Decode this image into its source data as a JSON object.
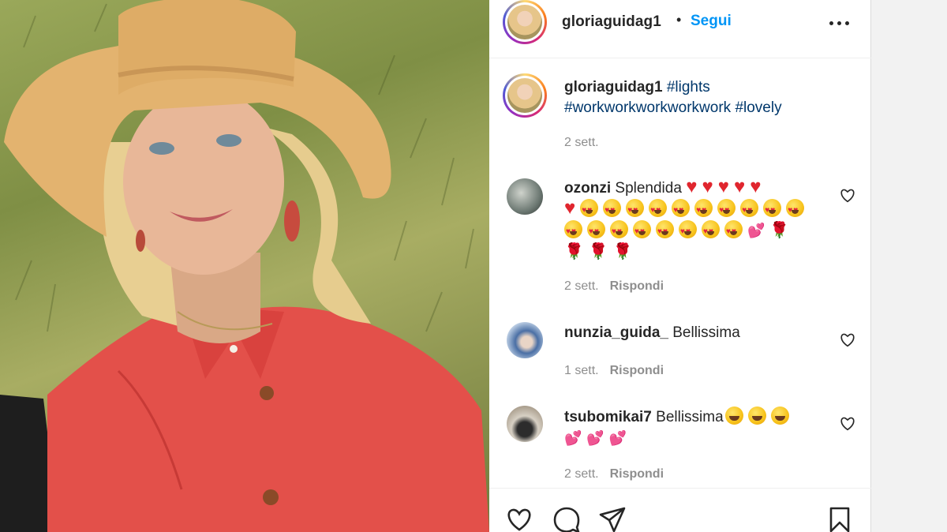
{
  "post": {
    "username": "gloriaguidag1",
    "follow_label": "Segui",
    "separator": "•"
  },
  "caption": {
    "username": "gloriaguidag1",
    "hashtags": [
      "#lights",
      "#workworkworkworkwork",
      "#lovely"
    ],
    "time": "2 sett."
  },
  "comments": [
    {
      "username": "ozonzi",
      "text": "Splendida",
      "emoji": {
        "red_hearts": 6,
        "heart_eyes": 17,
        "pink_hearts": 1,
        "roses": 3
      },
      "time": "2 sett.",
      "reply_label": "Rispondi"
    },
    {
      "username": "nunzia_guida_",
      "text": "Bellissima",
      "time": "1 sett.",
      "reply_label": "Rispondi"
    },
    {
      "username": "tsubomikai7",
      "text": "Bellissima",
      "emoji": {
        "faces": 3,
        "pink_hearts": 3
      },
      "time": "2 sett.",
      "reply_label": "Rispondi"
    }
  ],
  "icons": {
    "more": "more-horizontal-icon",
    "like": "heart-icon",
    "comment": "comment-icon",
    "share": "send-icon",
    "save": "bookmark-icon"
  },
  "colors": {
    "link_blue": "#0095f6",
    "hashtag": "#00376b",
    "muted": "#8e8e8e"
  }
}
